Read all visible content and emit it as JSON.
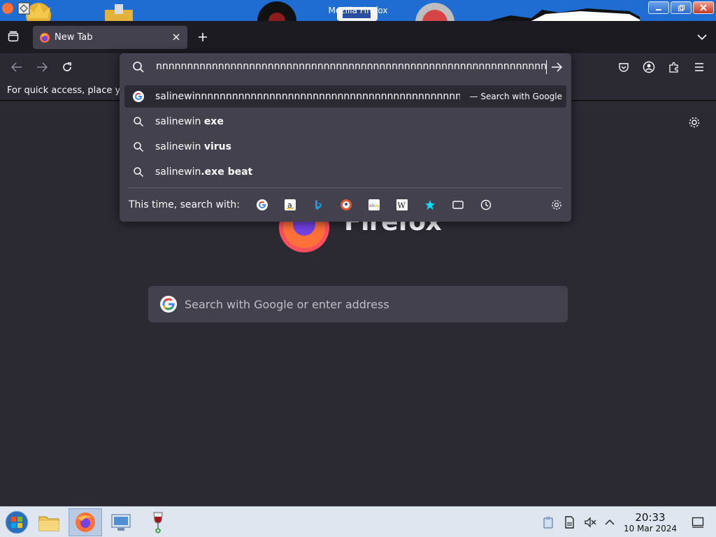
{
  "window": {
    "title": "Mozilla Firefox"
  },
  "tabs": [
    {
      "label": "New Tab",
      "favicon": "firefox-icon",
      "active": true
    }
  ],
  "bookmarks_bar": {
    "text": "For quick access, place y"
  },
  "url_bar": {
    "value": "nnnnnnnnnnnnnnnnnnnnnnnnnnnnnnnnnnnnnnnnnnnnnnnnnnnnnnnnnnnnnnnnn"
  },
  "suggestions": [
    {
      "prefix": "salinewinnnnnnnnnnnnnnnnnnnnnnnnnnnnnnnnnnnnnnnnnnnnnnnn",
      "bold": "",
      "icon": "google-icon",
      "action": "— Search with Google",
      "selected": true
    },
    {
      "prefix": "salinewin ",
      "bold": "exe",
      "icon": "search-icon",
      "action": "",
      "selected": false
    },
    {
      "prefix": "salinewin ",
      "bold": "virus",
      "icon": "search-icon",
      "action": "",
      "selected": false
    },
    {
      "prefix": "salinewin",
      "bold": ".exe beat",
      "icon": "search-icon",
      "action": "",
      "selected": false
    }
  ],
  "oneoff": {
    "label": "This time, search with:",
    "engines": [
      "google",
      "amazon",
      "bing",
      "duckduckgo",
      "ebay",
      "wikipedia",
      "bookmarks",
      "tabs",
      "history"
    ]
  },
  "newtab": {
    "wordmark": "Firefox",
    "search_placeholder": "Search with Google or enter address"
  },
  "taskbar": {
    "time": "20:33",
    "date": "10 Mar 2024"
  },
  "colors": {
    "chrome_bg": "#1c1b22",
    "toolbar_bg": "#2b2a33",
    "panel_bg": "#42414d",
    "text": "#fbfbfe",
    "taskbar_bg": "#dfe6ef"
  }
}
